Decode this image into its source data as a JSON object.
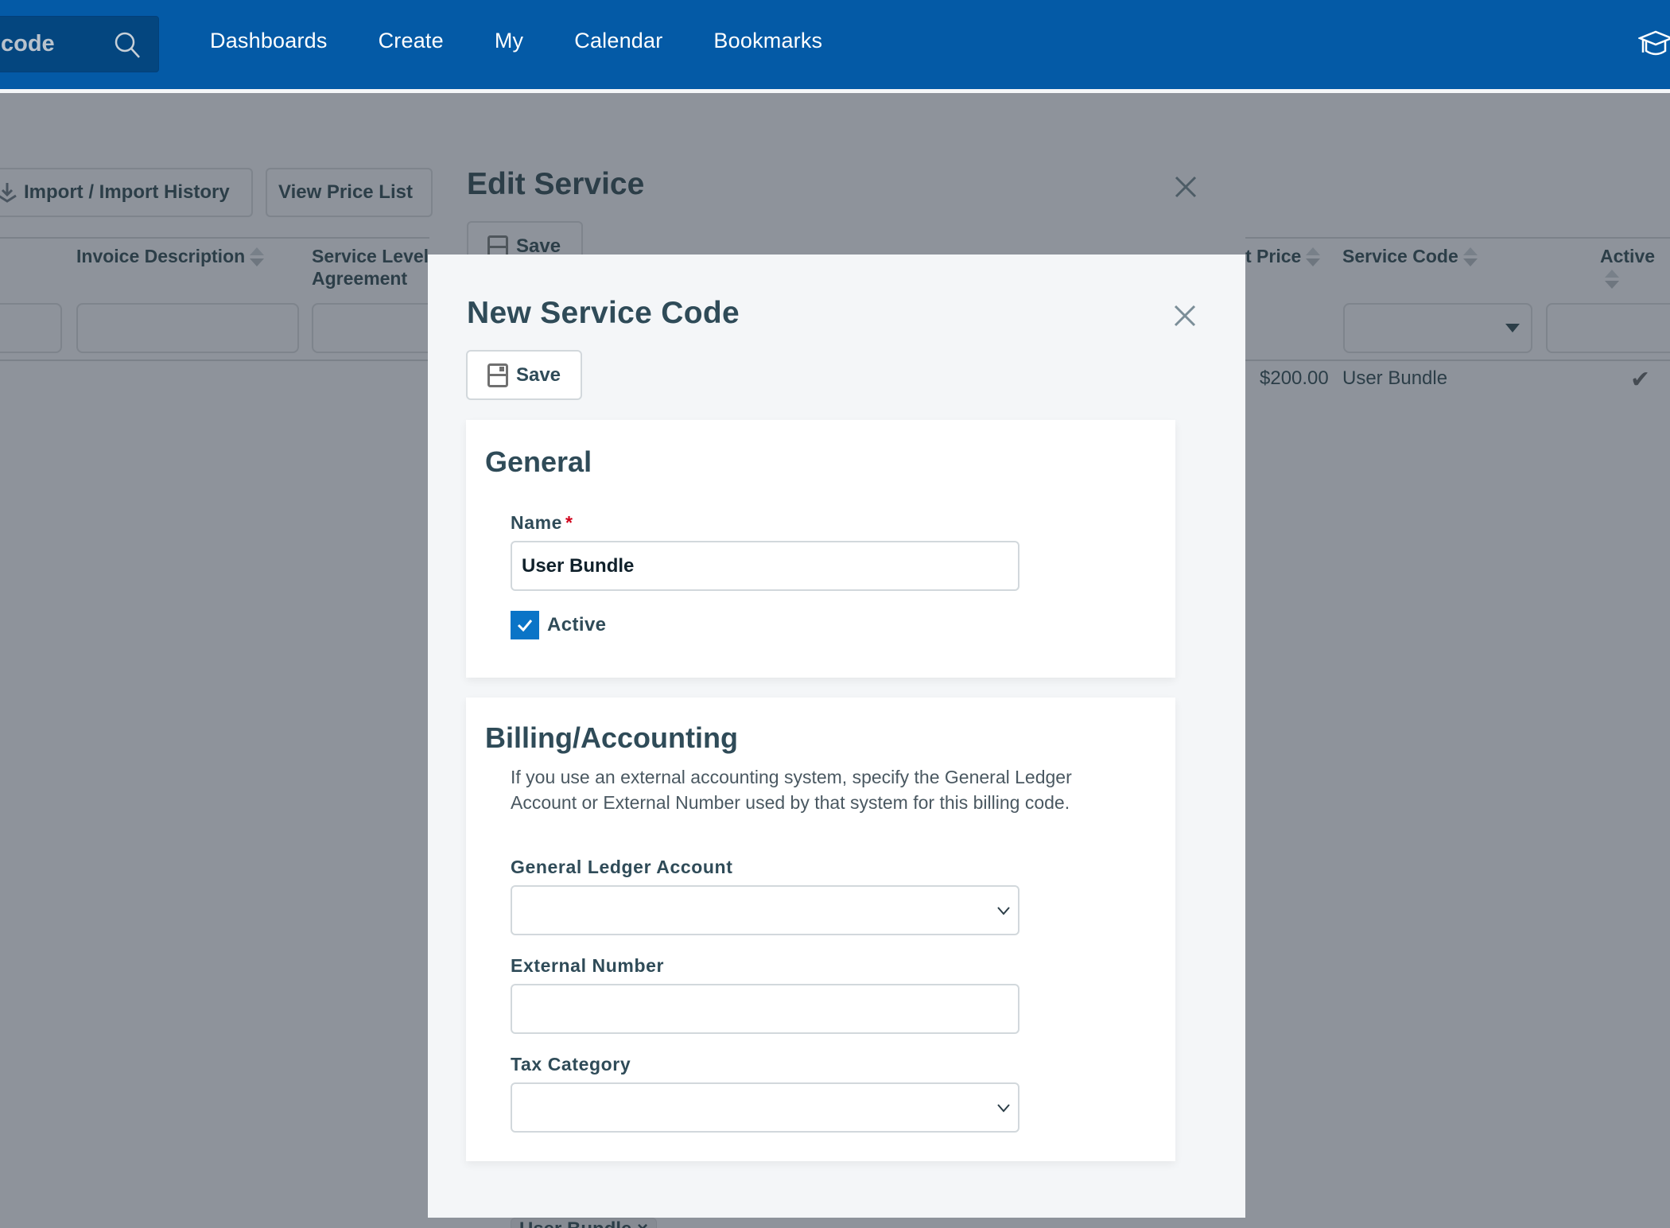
{
  "header": {
    "search_value": "code",
    "search_icon": "search-icon",
    "nav": [
      "Dashboards",
      "Create",
      "My",
      "Calendar",
      "Bookmarks"
    ],
    "right_icon": "graduation-cap-icon",
    "brand_color": "#045aa6"
  },
  "background": {
    "buttons": {
      "import": "Import / Import History",
      "price_list": "View Price List"
    },
    "columns": {
      "invoice_description": "Invoice Description",
      "sla_line1": "Service Level",
      "sla_line2": "Agreement",
      "price": "t Price",
      "service_code": "Service Code",
      "active": "Active"
    },
    "row": {
      "price": "$200.00",
      "service_code": "User Bundle",
      "active": "✔"
    },
    "edit_panel": {
      "title": "Edit Service",
      "save": "Save",
      "tag": "User Bundle ×"
    }
  },
  "modal": {
    "title": "New Service Code",
    "save_label": "Save",
    "general": {
      "title": "General",
      "name_label": "Name",
      "required_mark": "*",
      "name_value": "User Bundle",
      "active_label": "Active",
      "active_checked": true
    },
    "billing": {
      "title": "Billing/Accounting",
      "help_line1": "If you use an external accounting system, specify the General Ledger",
      "help_line2": "Account or External Number used by that system for this billing code.",
      "gl_label": "General Ledger Account",
      "gl_value": "",
      "external_label": "External Number",
      "external_value": "",
      "tax_label": "Tax Category",
      "tax_value": ""
    },
    "accent_color": "#0a74c7"
  }
}
